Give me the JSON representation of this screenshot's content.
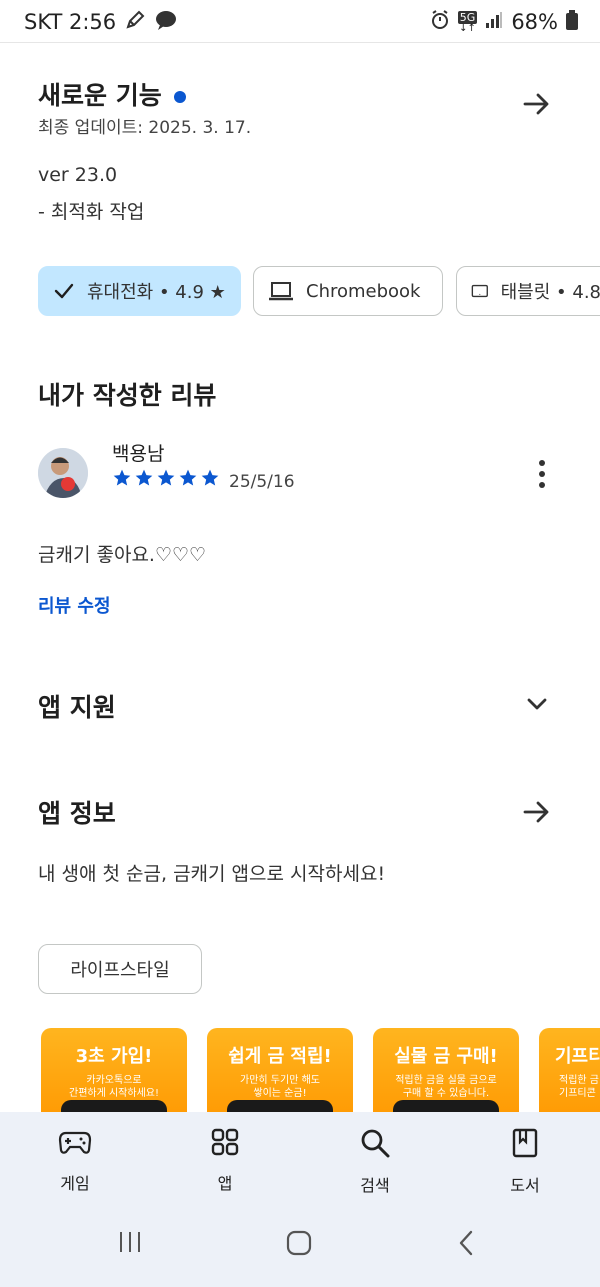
{
  "status_bar": {
    "carrier_time": "SKT 2:56",
    "network": "5G",
    "battery": "68%"
  },
  "whats_new": {
    "title": "새로운 기능",
    "updated": "최종 업데이트: 2025. 3. 17.",
    "version": "ver 23.0",
    "notes": "- 최적화 작업"
  },
  "device_chips": [
    {
      "label": "휴대전화 • 4.9 ★",
      "selected": true,
      "icon": "check-icon"
    },
    {
      "label": "Chromebook",
      "selected": false,
      "icon": "laptop-icon"
    },
    {
      "label": "태블릿 • 4.8",
      "selected": false,
      "icon": "tablet-icon"
    }
  ],
  "my_review": {
    "title": "내가 작성한 리뷰",
    "author": "백용남",
    "rating": 5,
    "date": "25/5/16",
    "text": "금캐기 좋아요.♡♡♡",
    "edit_link": "리뷰 수정"
  },
  "app_support": {
    "title": "앱 지원"
  },
  "app_info": {
    "title": "앱 정보",
    "description": "내 생애 첫 순금, 금캐기 앱으로 시작하세요!",
    "category_tag": "라이프스타일"
  },
  "screenshots": [
    {
      "heading": "3초 가입!",
      "line1": "카카오톡으로",
      "line2": "간편하게 시작하세요!"
    },
    {
      "heading": "쉽게 금 적립!",
      "line1": "가만히 두기만 해도",
      "line2": "쌓이는 순금!"
    },
    {
      "heading": "실물 금 구매!",
      "line1": "적립한 금을 실물 금으로",
      "line2": "구매 할 수 있습니다."
    },
    {
      "heading": "기프티",
      "line1": "적립한 금",
      "line2": "기프티콘"
    }
  ],
  "bottom_nav": [
    {
      "label": "게임",
      "icon": "gamepad-icon"
    },
    {
      "label": "앱",
      "icon": "apps-grid-icon"
    },
    {
      "label": "검색",
      "icon": "search-icon"
    },
    {
      "label": "도서",
      "icon": "book-icon"
    }
  ],
  "colors": {
    "accent": "#0b57d0",
    "chip_selected": "#c2e7ff",
    "screenshot_bg": "#ff9f0a",
    "nav_bg": "#edf1f8"
  }
}
